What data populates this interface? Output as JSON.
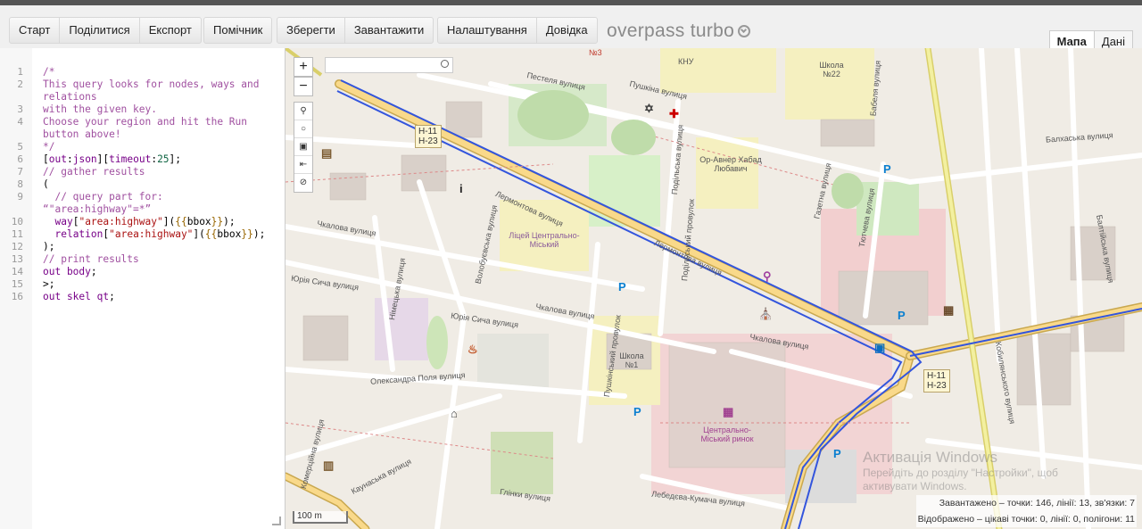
{
  "toolbar": {
    "start": "Старт",
    "share": "Поділитися",
    "export": "Експорт",
    "wizard": "Помічник",
    "save": "Зберегти",
    "load": "Завантажити",
    "settings": "Налаштування",
    "help": "Довідка"
  },
  "app_title": "overpass turbo",
  "view_tabs": {
    "map": "Мапа",
    "data": "Дані"
  },
  "editor": {
    "line_numbers": [
      "1",
      "2",
      "",
      "3",
      "4",
      "",
      "5",
      "6",
      "7",
      "8",
      "9",
      "",
      "10",
      "11",
      "12",
      "13",
      "14",
      "15",
      "16"
    ]
  },
  "map": {
    "scale_label": "100 m",
    "zoom_in": "+",
    "zoom_out": "−",
    "status_loaded": "Завантажено – точки: 146, лінії: 13, зв'язки: 7",
    "status_displayed": "Відображено – цікаві точки: 0, лінії: 0, полігони: 11",
    "watermark_title": "Активація Windows",
    "watermark_line1": "Перейдіть до розділу \"Настройки\", щоб",
    "watermark_line2": "активувати Windows.",
    "road_signs": [
      [
        "Н-11",
        "Н-23"
      ],
      [
        "Н-11",
        "Н-23"
      ]
    ],
    "street_labels": [
      "Пестеля вулиця",
      "Пушкіна вулиця",
      "Балхаська вулиця",
      "Лермонтова вулиця",
      "Чкалова вулиця",
      "Юрія Сича вулиця",
      "Олександра Поля вулиця",
      "Глінки вулиця",
      "Лебедєва-Кумача вулиця",
      "Кобилянського вулиця",
      "Комерційна вулиця",
      "Каунаська вулиця",
      "Подільська вулиця",
      "Подільський провулок",
      "Тютчева вулиця",
      "Газетна вулиця",
      "Пушкінський провулок",
      "Волобуєвська вулиця",
      "Німецька вулиця",
      "Бабеля вулиця",
      "Балтійська вулиця"
    ],
    "poi_labels": [
      "КНУ",
      "Школа №22",
      "Ор-Авнер Хабад Любавич",
      "Ліцей Центрально-Міський",
      "Школа №1",
      "Центрально-Міський ринок",
      "№3"
    ]
  }
}
